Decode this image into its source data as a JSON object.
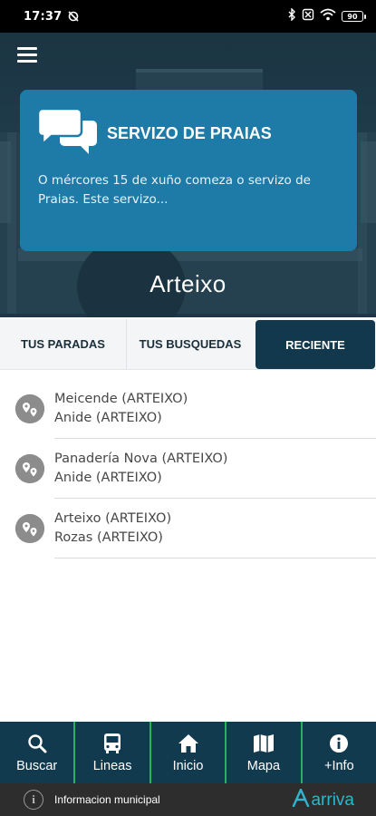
{
  "status_bar": {
    "time": "17:37",
    "battery": "90"
  },
  "hero": {
    "news": {
      "title": "SERVIZO DE PRAIAS",
      "body": "O mércores 15 de xuño comeza o servizo de Praias. Este servizo..."
    },
    "brand": "Arteixo"
  },
  "tabs": [
    {
      "label": "TUS PARADAS",
      "active": false
    },
    {
      "label": "TUS BUSQUEDAS",
      "active": false
    },
    {
      "label": "RECIENTE",
      "active": true
    }
  ],
  "recent": [
    {
      "from": "Meicende (ARTEIXO)",
      "to": "Anide (ARTEIXO)"
    },
    {
      "from": "Panadería Nova (ARTEIXO)",
      "to": "Anide (ARTEIXO)"
    },
    {
      "from": "Arteixo (ARTEIXO)",
      "to": "Rozas (ARTEIXO)"
    }
  ],
  "bottom_nav": [
    {
      "label": "Buscar",
      "icon": "search-icon"
    },
    {
      "label": "Lineas",
      "icon": "bus-icon"
    },
    {
      "label": "Inicio",
      "icon": "home-icon"
    },
    {
      "label": "Mapa",
      "icon": "map-icon"
    },
    {
      "label": "+Info",
      "icon": "info-icon"
    }
  ],
  "footer": {
    "text": "Informacion municipal",
    "logo_text": "arriva"
  },
  "colors": {
    "card": "#1e7ba8",
    "nav_bg": "#123a4f",
    "nav_divider": "#27b158",
    "active_tab": "#12384d",
    "footer_bg": "#2d2d2d",
    "logo": "#31b4cf"
  }
}
